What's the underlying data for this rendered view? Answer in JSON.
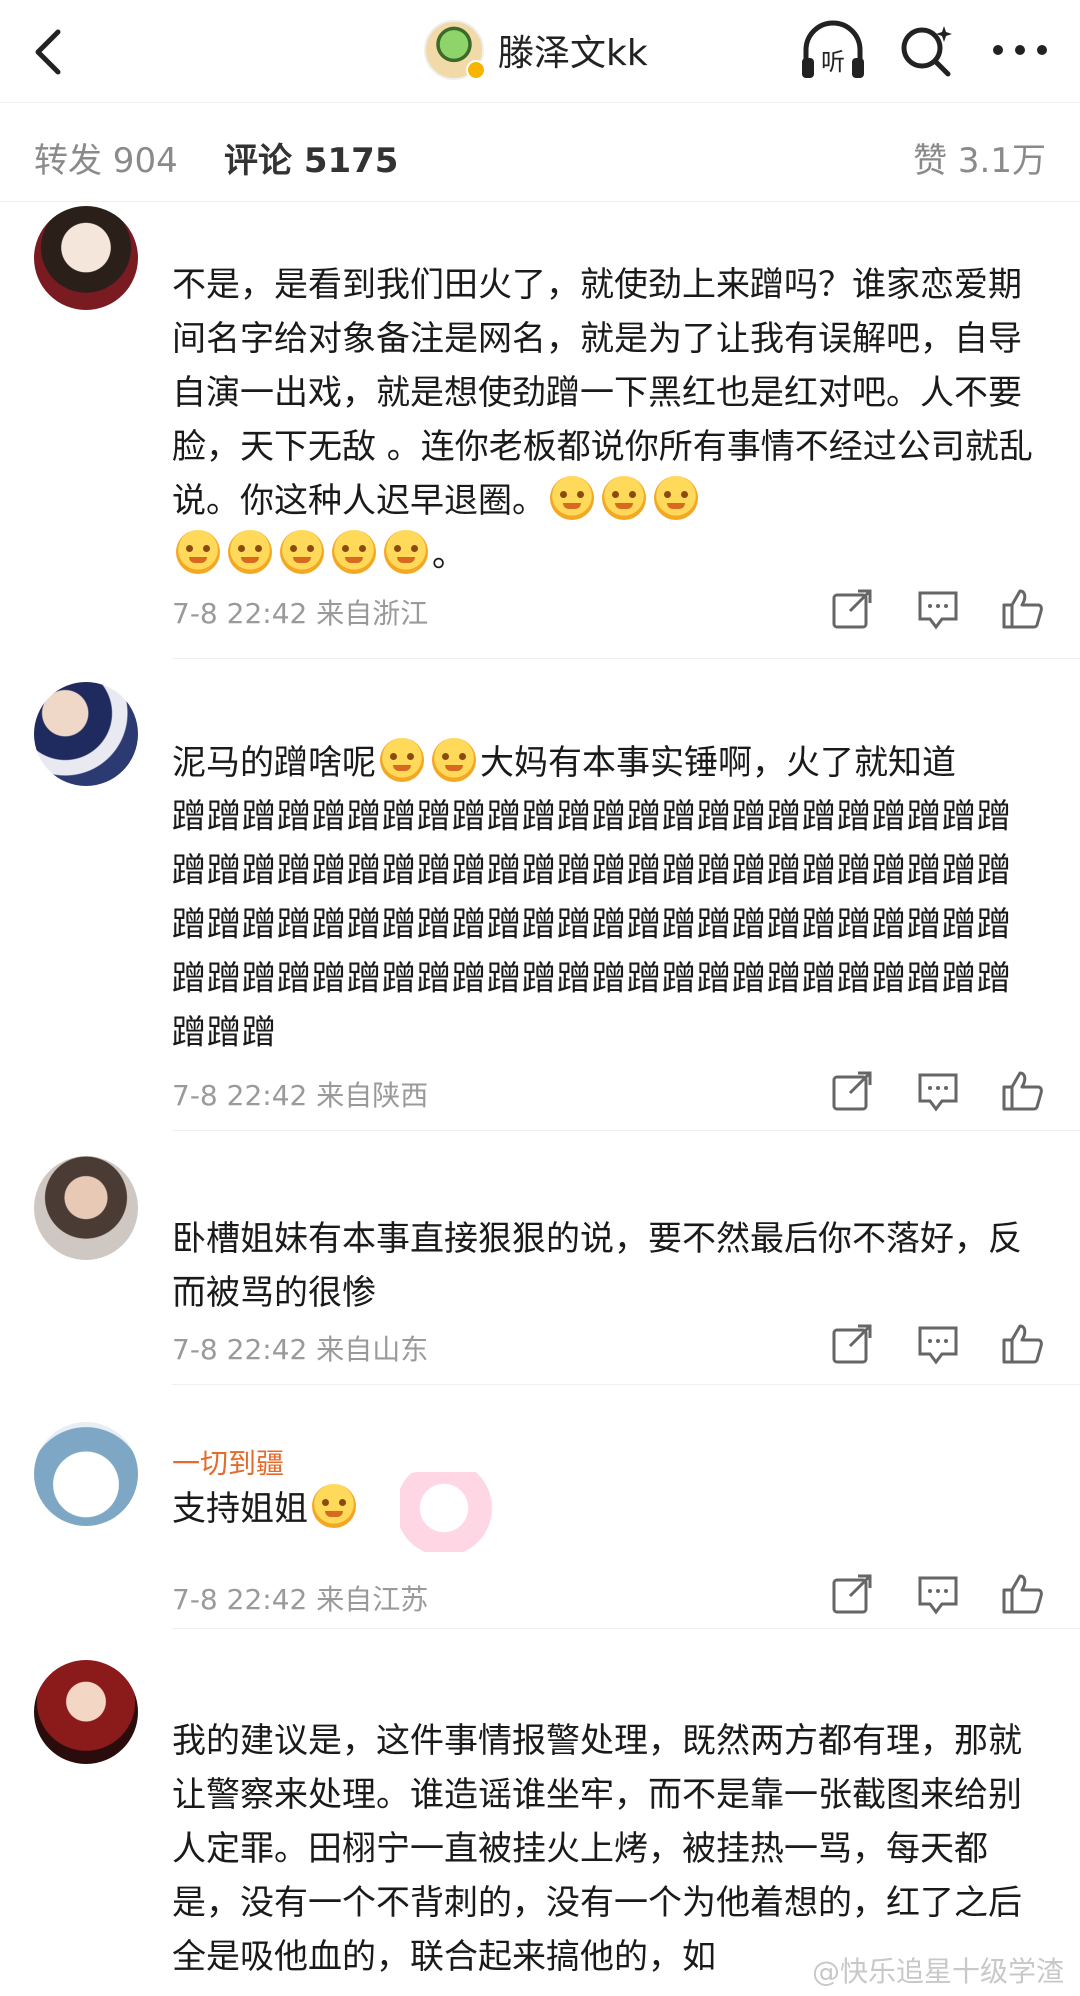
{
  "header": {
    "back_icon": "chevron-left-icon",
    "title": "滕泽文kk",
    "listen_label": "听",
    "icons": [
      "headphones-icon",
      "search-sparkle-icon",
      "more-dots-icon"
    ]
  },
  "tabs": {
    "repost": "转发 904",
    "comment": "评论 5175",
    "like": "赞 3.1万"
  },
  "comments": [
    {
      "text_parts": [
        "不是，是看到我们田火了，就使劲上来蹭吗？谁家恋爱期间名字给对象备注是网名，就是为了让我有误解吧，自导自演一出戏，就是想使劲蹭一下黑红也是红对吧。人不要脸，天下无敌 。连你老板都说你所有事情不经过公司就乱说。你这种人迟早退圈。"
      ],
      "emoji_count_a": 3,
      "emoji_count_b": 5,
      "tail": "。",
      "meta": "7-8 22:42 来自浙江"
    },
    {
      "text_a": "泥马的蹭啥呢",
      "text_b": "大妈有本事实锤啊，火了就知道",
      "text_c": "蹭蹭蹭蹭蹭蹭蹭蹭蹭蹭蹭蹭蹭蹭蹭蹭蹭蹭蹭蹭蹭蹭蹭蹭蹭蹭蹭蹭蹭蹭蹭蹭蹭蹭蹭蹭蹭蹭蹭蹭蹭蹭蹭蹭蹭蹭蹭蹭蹭蹭蹭蹭蹭蹭蹭蹭蹭蹭蹭蹭蹭蹭蹭蹭蹭蹭蹭蹭蹭蹭蹭蹭蹭蹭蹭蹭蹭蹭蹭蹭蹭蹭蹭蹭蹭蹭蹭蹭蹭蹭蹭蹭蹭蹭蹭蹭蹭蹭蹭",
      "meta": "7-8 22:42 来自陕西"
    },
    {
      "text": "卧槽姐妹有本事直接狠狠的说，要不然最后你不落好，反而被骂的很惨",
      "meta": "7-8 22:42 来自山东"
    },
    {
      "username": "一切到疆",
      "text": "支持姐姐",
      "meta": "7-8 22:42 来自江苏"
    },
    {
      "text": "我的建议是，这件事情报警处理，既然两方都有理，那就让警察来处理。谁造谣谁坐牢，而不是靠一张截图来给别人定罪。田栩宁一直被挂火上烤，被挂热一骂，每天都是，没有一个不背刺的，没有一个为他着想的，红了之后全是吸他血的，联合起来搞他的，如"
    }
  ],
  "watermark": "@快乐追星十级学渣",
  "action_icons": [
    "share-icon",
    "reply-icon",
    "thumb-up-icon"
  ]
}
